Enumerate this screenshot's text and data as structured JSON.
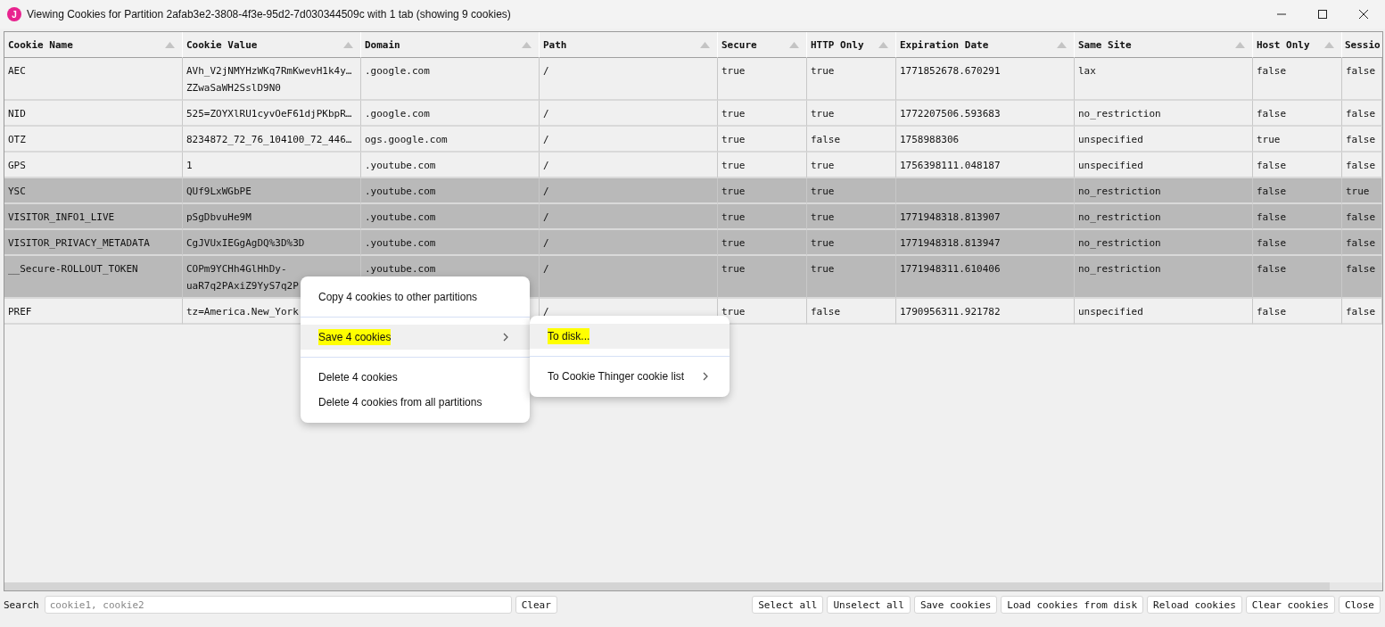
{
  "window": {
    "app_icon_letter": "J",
    "title": "Viewing Cookies for Partition 2afab3e2-3808-4f3e-95d2-7d030344509c with 1 tab (showing 9 cookies)"
  },
  "table": {
    "columns": [
      {
        "label": "Cookie Name",
        "sort_arrow": true
      },
      {
        "label": "Cookie Value",
        "sort_arrow": true
      },
      {
        "label": "Domain",
        "sort_arrow": true
      },
      {
        "label": "Path",
        "sort_arrow": true
      },
      {
        "label": "Secure",
        "sort_arrow": true
      },
      {
        "label": "HTTP Only",
        "sort_arrow": true
      },
      {
        "label": "Expiration Date",
        "sort_arrow": true
      },
      {
        "label": "Same Site",
        "sort_arrow": true
      },
      {
        "label": "Host Only",
        "sort_arrow": true
      },
      {
        "label": "Sessio",
        "sort_arrow": false
      }
    ],
    "rows": [
      {
        "selected": false,
        "cells": [
          "AEC",
          "AVh_V2jNMYHzWKq7RmKwevH1k4y…\nZZwaSaWH2SslD9N0",
          ".google.com",
          "/",
          "true",
          "true",
          "1771852678.670291",
          "lax",
          "false",
          "false"
        ]
      },
      {
        "selected": false,
        "cells": [
          "NID",
          "525=ZOYXlRU1cyvOeF61djPKbpR…",
          ".google.com",
          "/",
          "true",
          "true",
          "1772207506.593683",
          "no_restriction",
          "false",
          "false"
        ]
      },
      {
        "selected": false,
        "cells": [
          "OTZ",
          "8234872_72_76_104100_72_446…",
          "ogs.google.com",
          "/",
          "true",
          "false",
          "1758988306",
          "unspecified",
          "true",
          "false"
        ]
      },
      {
        "selected": false,
        "cells": [
          "GPS",
          "1",
          ".youtube.com",
          "/",
          "true",
          "true",
          "1756398111.048187",
          "unspecified",
          "false",
          "false"
        ]
      },
      {
        "selected": true,
        "cells": [
          "YSC",
          "QUf9LxWGbPE",
          ".youtube.com",
          "/",
          "true",
          "true",
          "",
          "no_restriction",
          "false",
          "true"
        ]
      },
      {
        "selected": true,
        "cells": [
          "VISITOR_INFO1_LIVE",
          "pSgDbvuHe9M",
          ".youtube.com",
          "/",
          "true",
          "true",
          "1771948318.813907",
          "no_restriction",
          "false",
          "false"
        ]
      },
      {
        "selected": true,
        "cells": [
          "VISITOR_PRIVACY_METADATA",
          "CgJVUxIEGgAgDQ%3D%3D",
          ".youtube.com",
          "/",
          "true",
          "true",
          "1771948318.813947",
          "no_restriction",
          "false",
          "false"
        ]
      },
      {
        "selected": true,
        "cells": [
          "__Secure-ROLLOUT_TOKEN",
          "COPm9YCHh4GlHhDy-\nuaR7q2PAxiZ9YyS7q2P",
          ".youtube.com",
          "/",
          "true",
          "true",
          "1771948311.610406",
          "no_restriction",
          "false",
          "false"
        ]
      },
      {
        "selected": false,
        "cells": [
          "PREF",
          "tz=America.New_York",
          "",
          "/",
          "true",
          "false",
          "1790956311.921782",
          "unspecified",
          "false",
          "false"
        ]
      }
    ]
  },
  "context_menu": {
    "items": [
      {
        "kind": "item",
        "label": "Copy 4 cookies to other partitions",
        "highlighted": false,
        "marked": false,
        "submenu_arrow": false
      },
      {
        "kind": "separator"
      },
      {
        "kind": "item",
        "label": "Save 4 cookies",
        "highlighted": true,
        "marked": true,
        "submenu_arrow": true
      },
      {
        "kind": "separator"
      },
      {
        "kind": "item",
        "label": "Delete 4 cookies",
        "highlighted": false,
        "marked": false,
        "submenu_arrow": false
      },
      {
        "kind": "item",
        "label": "Delete 4 cookies from all partitions",
        "highlighted": false,
        "marked": false,
        "submenu_arrow": false
      }
    ]
  },
  "submenu": {
    "items": [
      {
        "kind": "item",
        "label": "To disk...",
        "highlighted": true,
        "marked": true,
        "submenu_arrow": false
      },
      {
        "kind": "separator"
      },
      {
        "kind": "item",
        "label": "To Cookie Thinger cookie list",
        "highlighted": false,
        "marked": false,
        "submenu_arrow": true
      }
    ]
  },
  "search": {
    "label": "Search",
    "placeholder": "cookie1, cookie2",
    "clear_button": "Clear"
  },
  "buttons": [
    "Select all",
    "Unselect all",
    "Save cookies",
    "Load cookies from disk",
    "Reload cookies",
    "Clear cookies",
    "Close"
  ]
}
